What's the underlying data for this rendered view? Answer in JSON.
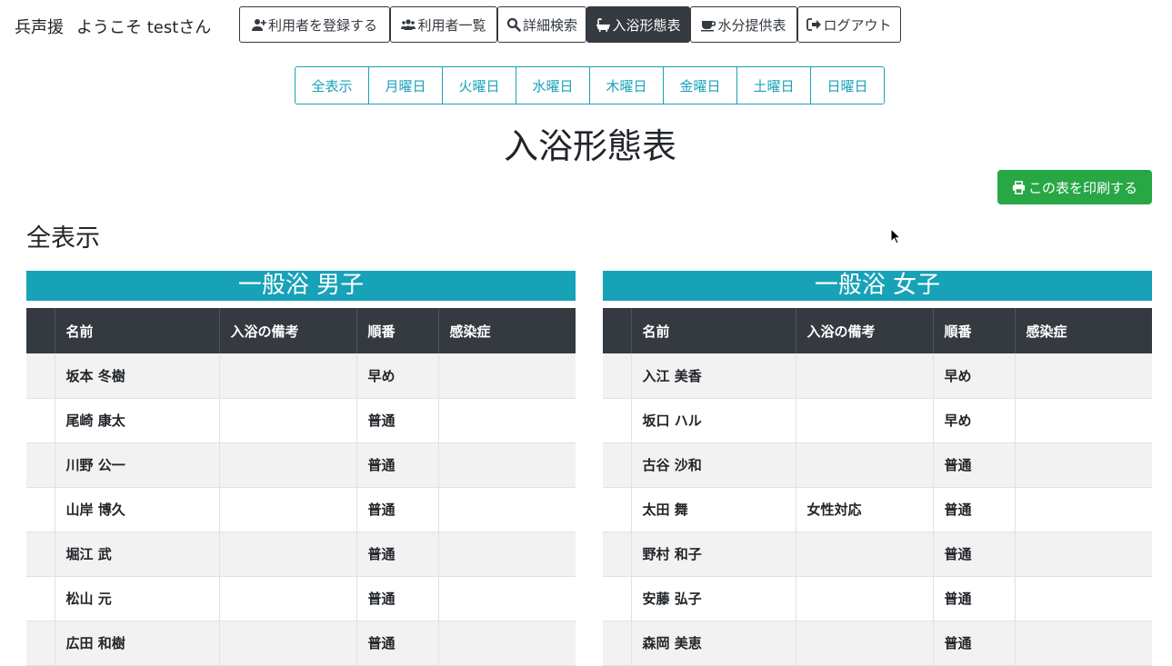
{
  "brand": {
    "name": "兵声援",
    "welcome": "ようこそ testさん"
  },
  "nav": {
    "register_user": "利用者を登録する",
    "user_list": "利用者一覧",
    "detail_search": "詳細検索",
    "bath_table": "入浴形態表",
    "water_table": "水分提供表",
    "logout": "ログアウト"
  },
  "days": [
    "全表示",
    "月曜日",
    "火曜日",
    "水曜日",
    "木曜日",
    "金曜日",
    "土曜日",
    "日曜日"
  ],
  "title": "入浴形態表",
  "print_label": "この表を印刷する",
  "section": "全表示",
  "columns": [
    "名前",
    "入浴の備考",
    "順番",
    "感染症"
  ],
  "panels": [
    {
      "title": "一般浴 男子",
      "rows": [
        {
          "name": "坂本 冬樹",
          "note": "",
          "order": "早め",
          "infection": ""
        },
        {
          "name": "尾崎 康太",
          "note": "",
          "order": "普通",
          "infection": ""
        },
        {
          "name": "川野 公一",
          "note": "",
          "order": "普通",
          "infection": ""
        },
        {
          "name": "山岸 博久",
          "note": "",
          "order": "普通",
          "infection": ""
        },
        {
          "name": "堀江 武",
          "note": "",
          "order": "普通",
          "infection": ""
        },
        {
          "name": "松山 元",
          "note": "",
          "order": "普通",
          "infection": ""
        },
        {
          "name": "広田 和樹",
          "note": "",
          "order": "普通",
          "infection": ""
        }
      ]
    },
    {
      "title": "一般浴 女子",
      "rows": [
        {
          "name": "入江 美香",
          "note": "",
          "order": "早め",
          "infection": ""
        },
        {
          "name": "坂口 ハル",
          "note": "",
          "order": "早め",
          "infection": ""
        },
        {
          "name": "古谷 沙和",
          "note": "",
          "order": "普通",
          "infection": ""
        },
        {
          "name": "太田 舞",
          "note": "女性対応",
          "order": "普通",
          "infection": ""
        },
        {
          "name": "野村 和子",
          "note": "",
          "order": "普通",
          "infection": ""
        },
        {
          "name": "安藤 弘子",
          "note": "",
          "order": "普通",
          "infection": ""
        },
        {
          "name": "森岡 美恵",
          "note": "",
          "order": "普通",
          "infection": ""
        }
      ]
    }
  ],
  "colors": {
    "primary_dark": "#343a40",
    "info": "#17a2b8",
    "success": "#28a745"
  }
}
